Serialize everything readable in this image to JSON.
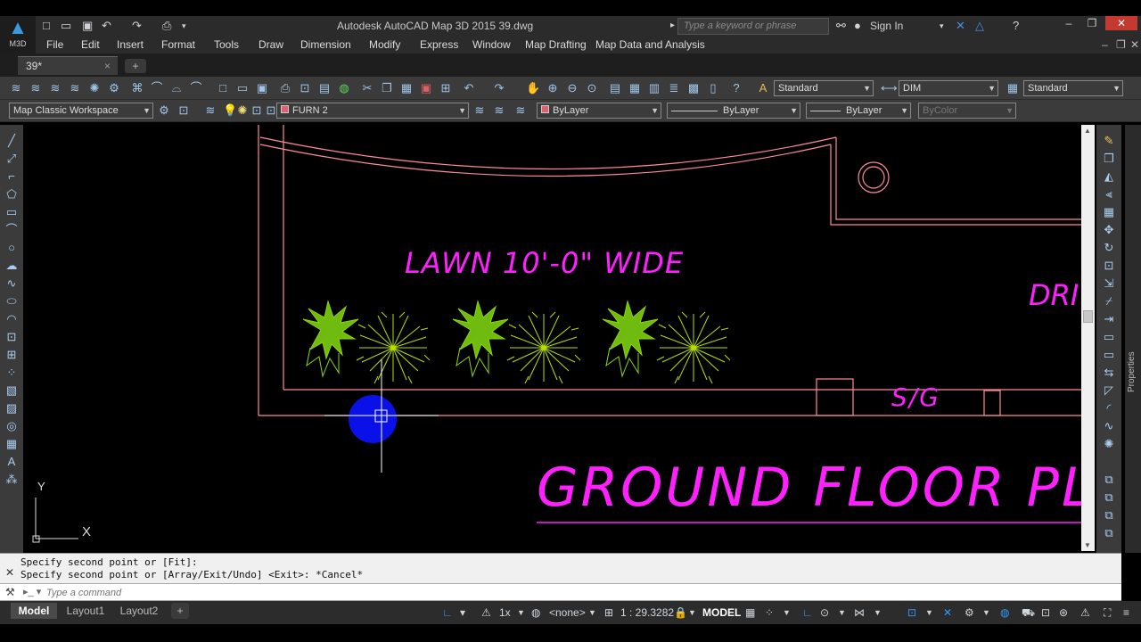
{
  "app": {
    "logo_text": "M3D",
    "title": "Autodesk AutoCAD Map 3D 2015    39.dwg",
    "search_placeholder": "Type a keyword or phrase",
    "sign_in": "Sign In",
    "help": "?"
  },
  "menu": [
    "File",
    "Edit",
    "Insert",
    "Format",
    "Tools",
    "Draw",
    "Dimension",
    "Modify",
    "Express",
    "Window",
    "Map Drafting",
    "Map Data and Analysis"
  ],
  "tabs": {
    "file": "39*",
    "close": "×",
    "new": "+"
  },
  "toolbar": {
    "text_style": "Standard",
    "dim_style": "DIM",
    "table_style": "Standard",
    "workspace": "Map Classic Workspace",
    "layer": "FURN 2",
    "color": "ByLayer",
    "linetype": "ByLayer",
    "lineweight": "ByLayer",
    "plotstyle": "ByColor"
  },
  "drawing": {
    "lawn_label": "LAWN 10'-0\" WIDE",
    "dri_label": "DRI",
    "sg_label": "S/G",
    "plan_title": "GROUND FLOOR PLA",
    "ucs_y": "Y",
    "ucs_x": "X"
  },
  "properties_label": "Properties",
  "command": {
    "history": [
      "Specify second point or [Fit]:",
      "Specify second point or [Array/Exit/Undo] <Exit>: *Cancel*"
    ],
    "placeholder": "Type a command"
  },
  "layout_tabs": [
    "Model",
    "Layout1",
    "Layout2"
  ],
  "status": {
    "annoscale_factor": "1x",
    "annovis": "<none>",
    "scale": "1 : 29.3282",
    "space": "MODEL"
  }
}
